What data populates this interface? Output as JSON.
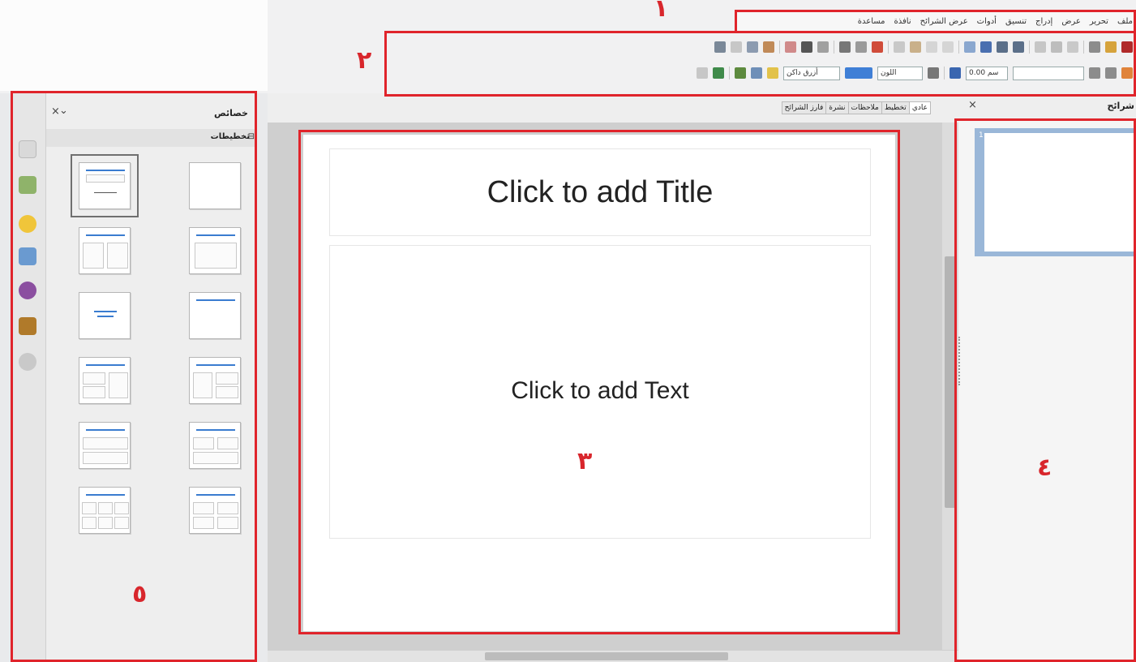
{
  "menubar": [
    "مساعدة",
    "نافذة",
    "عرض الشرائح",
    "أدوات",
    "تنسيق",
    "إدراج",
    "عرض",
    "تحرير",
    "ملف"
  ],
  "toolbar": {
    "font_color_label": "اللون",
    "line_width_value": "0.00 سم",
    "fill_label": "أزرق داكن"
  },
  "sidebar": {
    "title": "خصائص",
    "close": "×",
    "menu_glyph": "⌄",
    "layouts_label": "تخطيطات",
    "layouts_collapse": "⊟"
  },
  "editor": {
    "view_tabs": [
      "عادي",
      "تخطيط",
      "ملاحظات",
      "نشرة",
      "فارز الشرائح"
    ],
    "close": "×",
    "title_placeholder": "Click to add Title",
    "content_placeholder": "Click to add Text"
  },
  "slides_pane": {
    "title": "شرائح",
    "close": "×",
    "slide_number": "1"
  },
  "callouts": {
    "menubar": "١",
    "toolbars": "٢",
    "workspace": "٣",
    "slides_pane": "٤",
    "properties_sidebar": "٥"
  },
  "colors": {
    "callout_red": "#e0242b",
    "accent_blue": "#3a7cd0"
  }
}
